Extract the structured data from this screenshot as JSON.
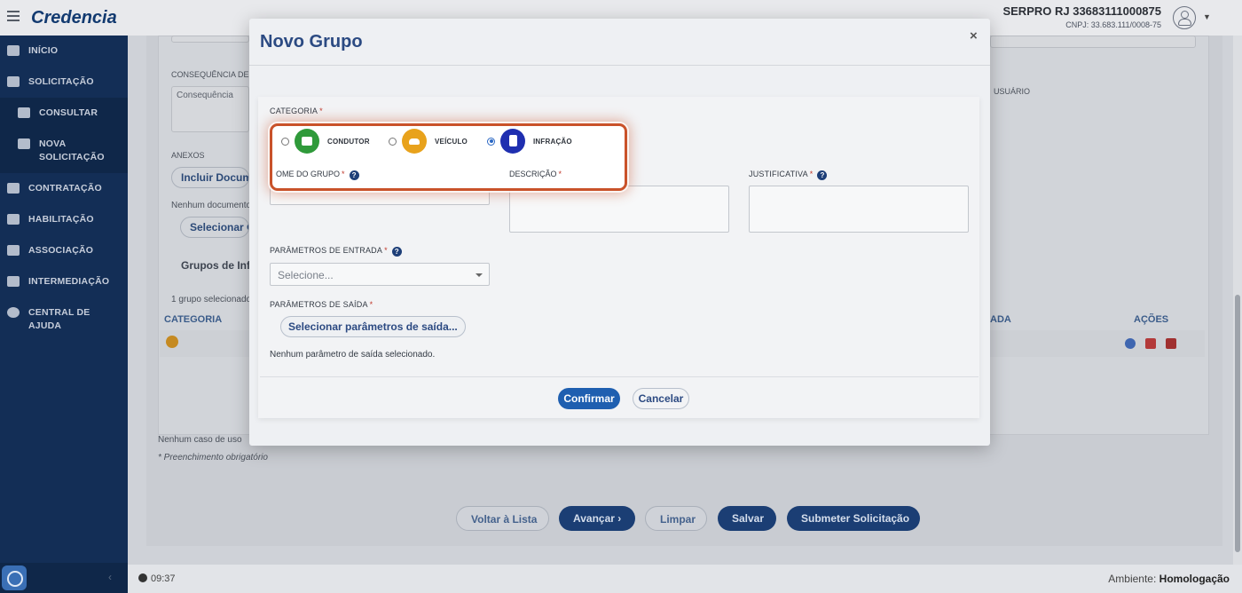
{
  "topbar": {
    "brand": "Credencia",
    "org_name": "SERPRO RJ 33683111000875",
    "org_cnpj": "CNPJ: 33.683.111/0008-75"
  },
  "sidebar": {
    "items": [
      {
        "label": "INÍCIO",
        "icon": "home-icon"
      },
      {
        "label": "SOLICITAÇÃO",
        "icon": "edit-icon"
      },
      {
        "label": "CONSULTAR",
        "icon": "search-icon"
      },
      {
        "label": "NOVA SOLICITAÇÃO",
        "icon": "file-icon"
      },
      {
        "label": "CONTRATAÇÃO",
        "icon": "handshake-icon"
      },
      {
        "label": "HABILITAÇÃO",
        "icon": "id-card-icon"
      },
      {
        "label": "ASSOCIAÇÃO",
        "icon": "users-icon"
      },
      {
        "label": "INTERMEDIAÇÃO",
        "icon": "person-network-icon"
      },
      {
        "label": "CENTRAL DE AJUDA",
        "icon": "question-icon"
      }
    ]
  },
  "background": {
    "consequencia_label": "CONSEQUÊNCIA DE",
    "consequencia_placeholder": "Consequência",
    "anexos_label": "ANEXOS",
    "incluir_documento": "Incluir Docum",
    "nenhum_documento": "Nenhum documento",
    "selecionar_g": "Selecionar G",
    "grupos_title": "Grupos de Inf",
    "grupo_selecionado": "1 grupo selecionado",
    "usuario_label": "USUÁRIO",
    "col_categoria": "CATEGORIA",
    "col_ada": "ADA",
    "col_acoes": "AÇÕES",
    "nenhum_caso": "Nenhum caso de uso",
    "preenchimento": "* Preenchimento obrigatório",
    "buttons": {
      "voltar": "Voltar à Lista",
      "avancar": "Avançar ›",
      "limpar": "Limpar",
      "salvar": "Salvar",
      "submeter": "Submeter Solicitação"
    }
  },
  "modal": {
    "title": "Novo Grupo",
    "close": "×",
    "categoria_label": "CATEGORIA",
    "categories": [
      {
        "label": "CONDUTOR",
        "color": "#2f9a3a",
        "icon": "id-card-icon",
        "selected": false
      },
      {
        "label": "VEÍCULO",
        "color": "#e8a21c",
        "icon": "car-icon",
        "selected": false
      },
      {
        "label": "INFRAÇÃO",
        "color": "#1f2fb0",
        "icon": "fine-document-icon",
        "selected": true
      }
    ],
    "nome_grupo_label": "OME DO GRUPO",
    "descricao_label": "DESCRIÇÃO",
    "justificativa_label": "JUSTIFICATIVA",
    "parametros_entrada_label": "PARÂMETROS DE ENTRADA",
    "parametros_entrada_placeholder": "Selecione...",
    "parametros_saida_label": "PARÂMETROS DE SAÍDA",
    "parametros_saida_button": "Selecionar parâmetros de saída...",
    "parametros_saida_note": "Nenhum parâmetro de saída selecionado.",
    "required_mark": "*",
    "help_glyph": "?",
    "confirm": "Confirmar",
    "cancel": "Cancelar"
  },
  "status": {
    "time": "09:37",
    "ambiente_label": "Ambiente:",
    "ambiente_value": "Homologação"
  }
}
